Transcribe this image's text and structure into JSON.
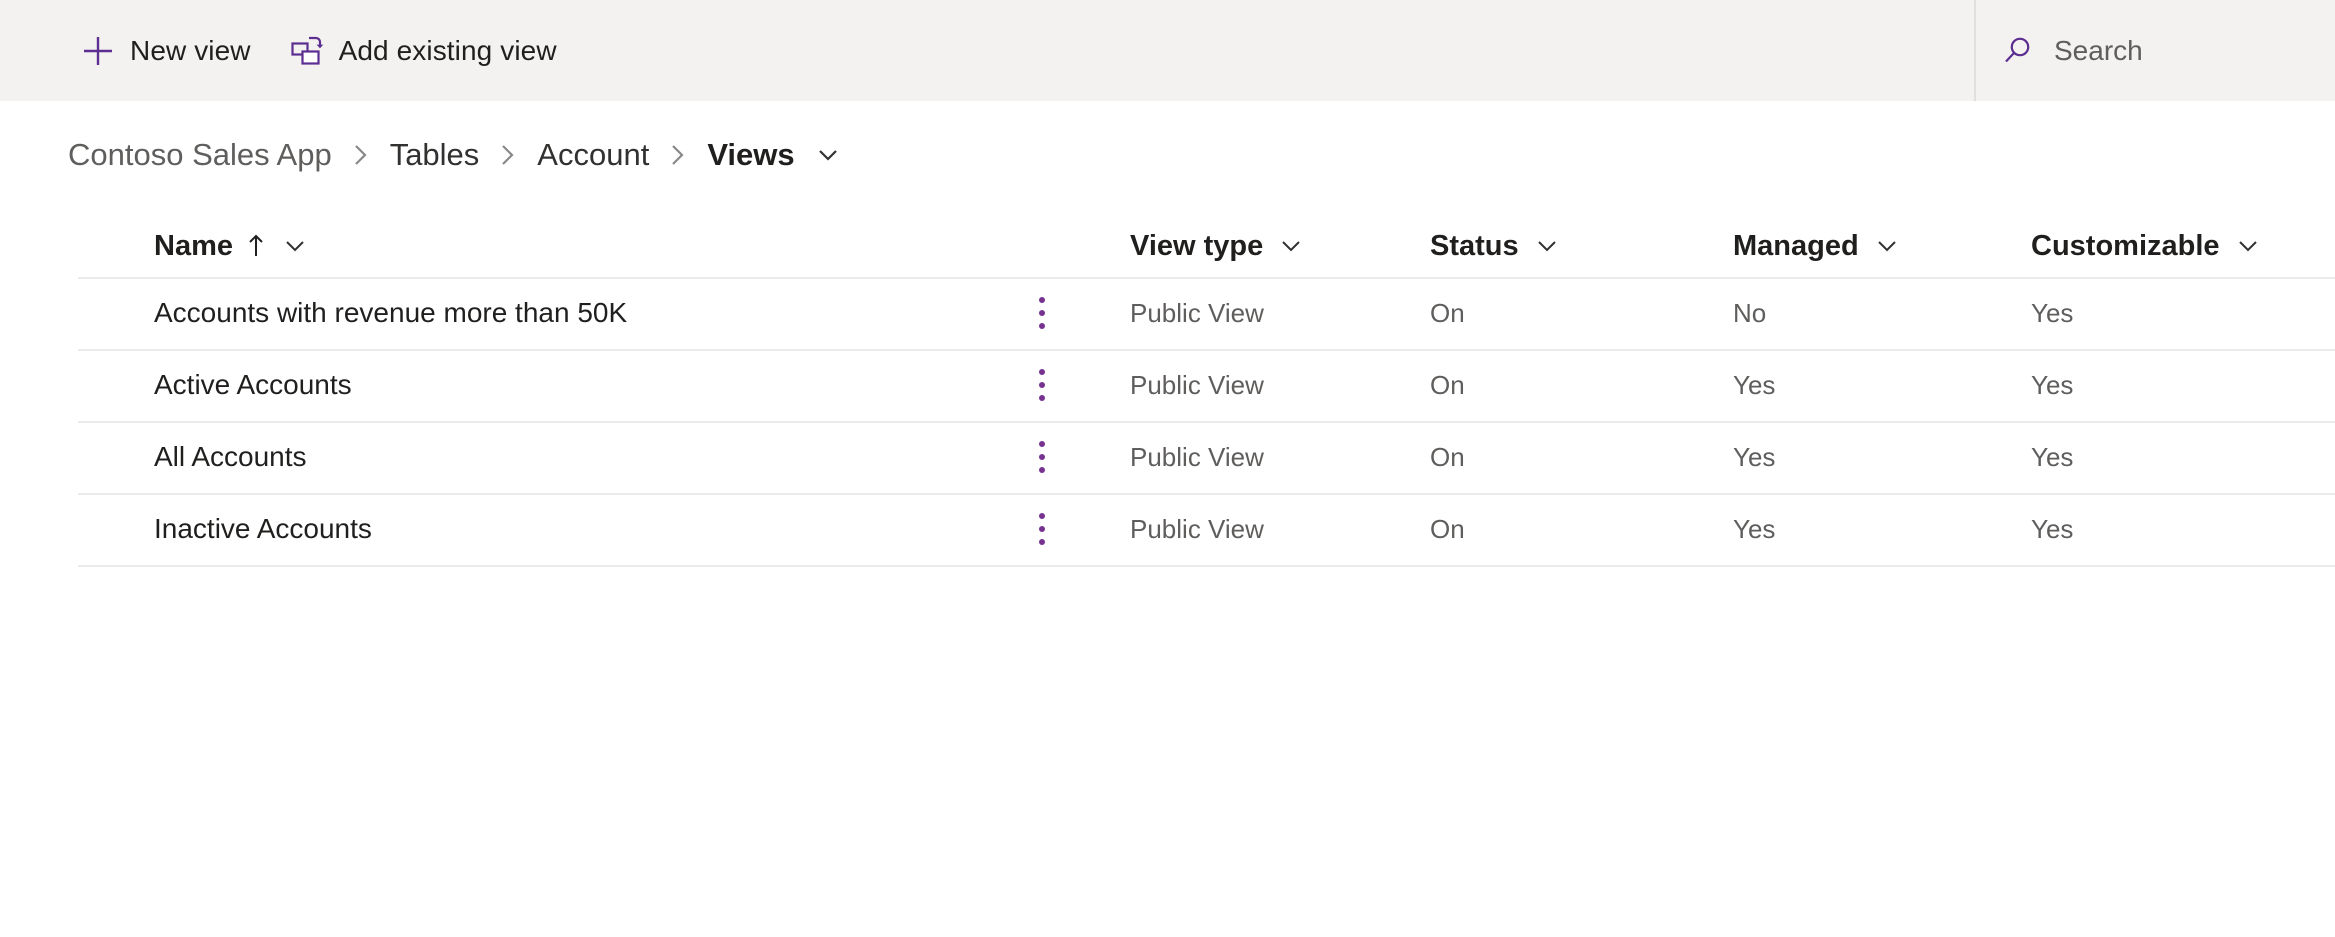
{
  "commandbar": {
    "new_view": {
      "label": "New view",
      "icon": "plus-icon"
    },
    "add_existing_view": {
      "label": "Add existing view",
      "icon": "add-existing-view-icon"
    },
    "search": {
      "label": "Search",
      "placeholder": "Search",
      "icon": "search-icon"
    },
    "accent_color": "#5c2e91",
    "background_color": "#f3f2f1"
  },
  "breadcrumb": {
    "separator": "›",
    "items": [
      {
        "label": "Contoso Sales App",
        "state": "link"
      },
      {
        "label": "Tables",
        "state": "link"
      },
      {
        "label": "Account",
        "state": "link"
      },
      {
        "label": "Views",
        "state": "current"
      }
    ],
    "chevron": "chevron-down-icon"
  },
  "table": {
    "columns": [
      {
        "key": "name",
        "label": "Name",
        "sort": "ascending",
        "sort_glyph": "↑",
        "has_menu": true
      },
      {
        "key": "view_type",
        "label": "View type",
        "sort": "none",
        "has_menu": true
      },
      {
        "key": "status",
        "label": "Status",
        "sort": "none",
        "has_menu": true
      },
      {
        "key": "managed",
        "label": "Managed",
        "sort": "none",
        "has_menu": true
      },
      {
        "key": "customizable",
        "label": "Customizable",
        "sort": "none",
        "has_menu": true
      }
    ],
    "rows": [
      {
        "name": "Accounts with revenue more than 50K",
        "view_type": "Public View",
        "status": "On",
        "managed": "No",
        "customizable": "Yes"
      },
      {
        "name": "Active Accounts",
        "view_type": "Public View",
        "status": "On",
        "managed": "Yes",
        "customizable": "Yes"
      },
      {
        "name": "All Accounts",
        "view_type": "Public View",
        "status": "On",
        "managed": "Yes",
        "customizable": "Yes"
      },
      {
        "name": "Inactive Accounts",
        "view_type": "Public View",
        "status": "On",
        "managed": "Yes",
        "customizable": "Yes"
      }
    ],
    "row_menu_icon": "more-options-icon",
    "row_menu_color": "#76328f",
    "grid_line_color": "#edebe9"
  }
}
